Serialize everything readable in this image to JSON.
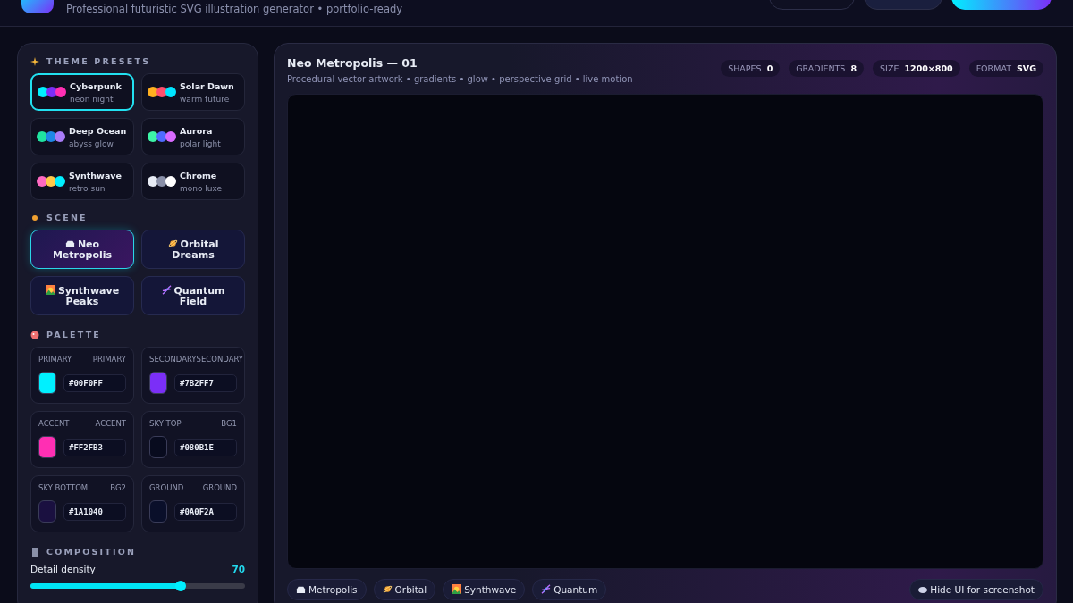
{
  "header": {
    "subtitle": "Professional futuristic SVG illustration generator • portfolio-ready"
  },
  "sidebar": {
    "presets_title": "THEME PRESETS",
    "presets": [
      {
        "name": "Cyberpunk",
        "desc": "neon night",
        "swatches": [
          {
            "color": "#00f0ff"
          },
          {
            "color": "#7b2ff7"
          },
          {
            "color": "#ff2fb3"
          }
        ],
        "selected": true
      },
      {
        "name": "Solar Dawn",
        "desc": "warm future",
        "swatches": [
          {
            "color": "#ffb020"
          },
          {
            "color": "#ff4f6d"
          },
          {
            "color": "#00e5ff"
          }
        ],
        "selected": false
      },
      {
        "name": "Deep Ocean",
        "desc": "abyss glow",
        "swatches": [
          {
            "color": "#20e3a0"
          },
          {
            "color": "#1e88e5"
          },
          {
            "color": "#a97cf8"
          }
        ],
        "selected": false
      },
      {
        "name": "Aurora",
        "desc": "polar light",
        "swatches": [
          {
            "color": "#3df5a7"
          },
          {
            "color": "#4f6bff"
          },
          {
            "color": "#d86bff"
          }
        ],
        "selected": false
      },
      {
        "name": "Synthwave",
        "desc": "retro sun",
        "swatches": [
          {
            "color": "#ff6ac1"
          },
          {
            "color": "#ffc94a"
          },
          {
            "color": "#00f0ff"
          }
        ],
        "selected": false
      },
      {
        "name": "Chrome",
        "desc": "mono luxe",
        "swatches": [
          {
            "color": "#e8ecf5"
          },
          {
            "color": "#8a90a8"
          },
          {
            "color": "#ffffff"
          }
        ],
        "selected": false
      }
    ],
    "scene_title": "SCENE",
    "scenes": [
      {
        "kind": "city",
        "label": "Neo Metropolis",
        "selected": true
      },
      {
        "kind": "planet",
        "label": "Orbital Dreams",
        "selected": false
      },
      {
        "kind": "peaks",
        "label": "Synthwave Peaks",
        "selected": false
      },
      {
        "kind": "dna",
        "label": "Quantum Field",
        "selected": false
      }
    ],
    "palette_title": "PALETTE",
    "palette": [
      {
        "label": "PRIMARY",
        "tag": "PRIMARY",
        "color": "#00f0ff",
        "value": "#00F0FF"
      },
      {
        "label": "SECONDARY",
        "tag": "SECONDARY",
        "color": "#7b2ff7",
        "value": "#7B2FF7"
      },
      {
        "label": "ACCENT",
        "tag": "ACCENT",
        "color": "#ff2fb3",
        "value": "#FF2FB3"
      },
      {
        "label": "SKY TOP",
        "tag": "BG1",
        "color": "#080b1e",
        "value": "#080B1E"
      },
      {
        "label": "SKY BOTTOM",
        "tag": "BG2",
        "color": "#1a1040",
        "value": "#1A1040"
      },
      {
        "label": "GROUND",
        "tag": "GROUND",
        "color": "#0a0f2a",
        "value": "#0A0F2A"
      }
    ],
    "composition_title": "COMPOSITION",
    "sliders": [
      {
        "label": "Detail density",
        "reading": "70",
        "level": 0.7
      }
    ]
  },
  "main": {
    "title": "Neo Metropolis — 01",
    "subtitle": "Procedural vector artwork • gradients • glow • perspective grid • live motion",
    "stats": [
      {
        "label": "SHAPES",
        "value": "0"
      },
      {
        "label": "GRADIENTS",
        "value": "8"
      },
      {
        "label": "SIZE",
        "value": "1200×800"
      },
      {
        "label": "FORMAT",
        "value": "SVG"
      }
    ],
    "chips": [
      {
        "kind": "city",
        "label": "Metropolis"
      },
      {
        "kind": "planet",
        "label": "Orbital"
      },
      {
        "kind": "peaks",
        "label": "Synthwave"
      },
      {
        "kind": "dna",
        "label": "Quantum"
      }
    ],
    "hide_button": "Hide UI for screenshot"
  }
}
